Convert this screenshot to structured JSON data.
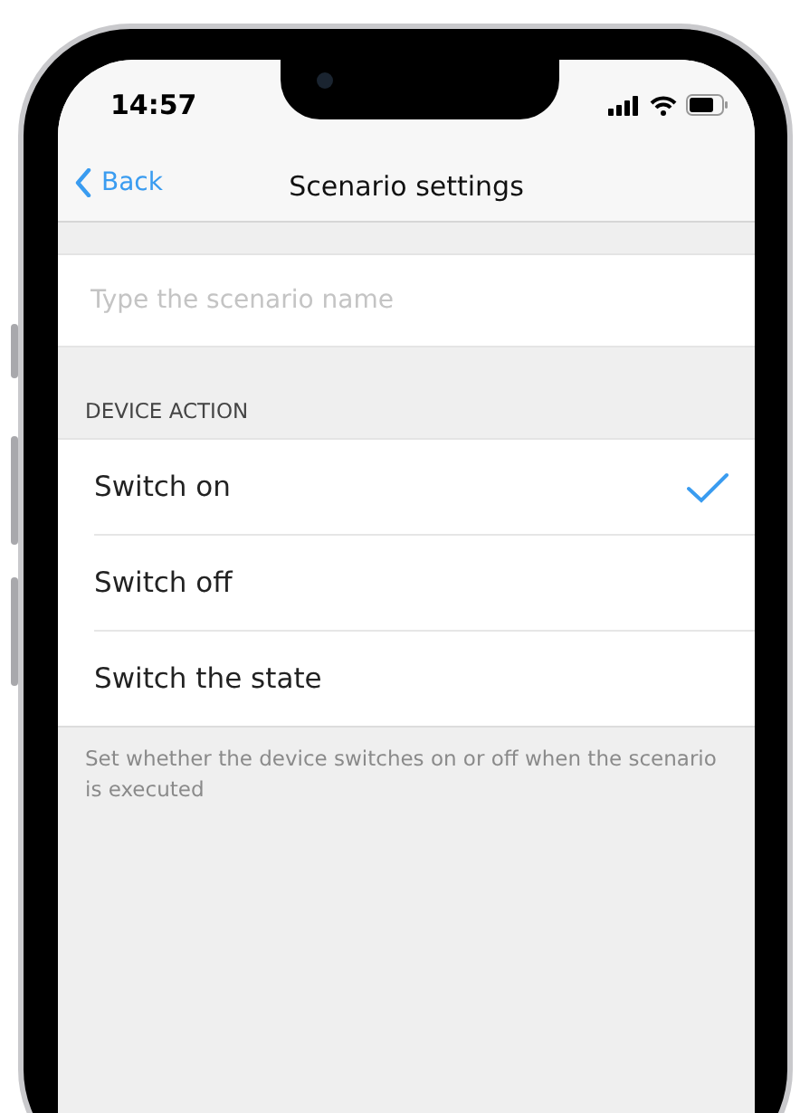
{
  "status_bar": {
    "time": "14:57"
  },
  "nav_bar": {
    "back": "Back",
    "title": "Scenario settings"
  },
  "name_field": {
    "placeholder": "Type the scenario name"
  },
  "device_action": {
    "header": "DEVICE ACTION",
    "options": [
      {
        "label": "Switch on",
        "selected": true
      },
      {
        "label": "Switch off",
        "selected": false
      },
      {
        "label": "Switch the state",
        "selected": false
      }
    ],
    "footer": "Set whether the device switches on or off when the scenario is executed"
  }
}
